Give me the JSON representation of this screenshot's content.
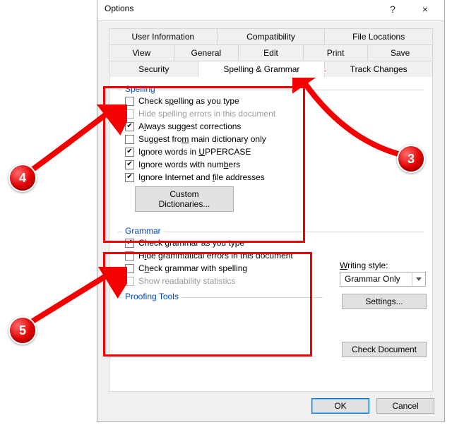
{
  "dialog": {
    "title": "Options",
    "help_label": "?",
    "close_label": "×"
  },
  "tabs": {
    "row1": [
      "User Information",
      "Compatibility",
      "File Locations"
    ],
    "row2": [
      "View",
      "General",
      "Edit",
      "Print",
      "Save"
    ],
    "row3": [
      "Security",
      "Spelling & Grammar",
      "Track Changes"
    ],
    "active": "Spelling & Grammar"
  },
  "spelling": {
    "legend": "Spelling",
    "opts": [
      {
        "label": "Check spelling as you type",
        "ul": "p",
        "checked": false,
        "disabled": false
      },
      {
        "label": "Hide spelling errors in this document",
        "checked": false,
        "disabled": true
      },
      {
        "label": "Always suggest corrections",
        "ul": "l",
        "checked": true,
        "disabled": false
      },
      {
        "label": "Suggest from main dictionary only",
        "ul": "m",
        "checked": false,
        "disabled": false
      },
      {
        "label": "Ignore words in UPPERCASE",
        "ul": "U",
        "checked": true,
        "disabled": false
      },
      {
        "label": "Ignore words with numbers",
        "ul": "b",
        "checked": true,
        "disabled": false
      },
      {
        "label": "Ignore Internet and file addresses",
        "ul": "f",
        "checked": true,
        "disabled": false
      }
    ],
    "btn": "Custom Dictionaries..."
  },
  "grammar": {
    "legend": "Grammar",
    "opts": [
      {
        "label": "Check grammar as you type",
        "checked": true,
        "disabled": false
      },
      {
        "label": "Hide grammatical errors in this document",
        "ul": "i",
        "checked": false,
        "disabled": false
      },
      {
        "label": "Check grammar with spelling",
        "ul": "h",
        "checked": false,
        "disabled": false
      },
      {
        "label": "Show readability statistics",
        "checked": false,
        "disabled": true
      }
    ]
  },
  "writing_style": {
    "label": "Writing style:",
    "ul": "W",
    "value": "Grammar Only"
  },
  "settings_btn": "Settings...",
  "proofing_legend": "Proofing Tools",
  "check_doc_btn": "Check Document",
  "ok_btn": "OK",
  "cancel_btn": "Cancel",
  "annotations": {
    "n3": "3",
    "n4": "4",
    "n5": "5"
  }
}
